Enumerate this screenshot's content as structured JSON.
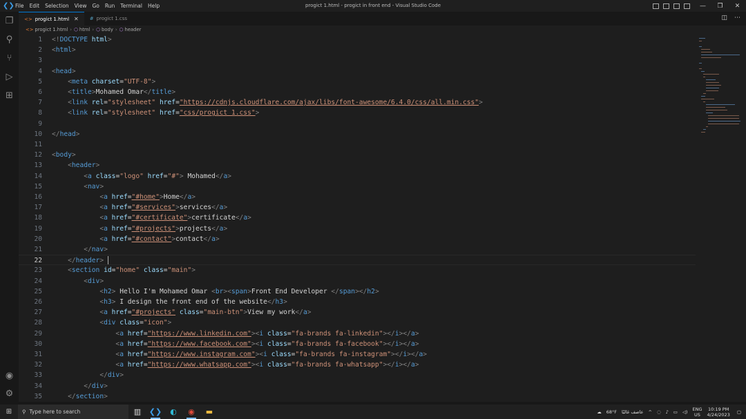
{
  "window": {
    "title": "progict 1.html - progict in front end - Visual Studio Code",
    "menu": [
      "File",
      "Edit",
      "Selection",
      "View",
      "Go",
      "Run",
      "Terminal",
      "Help"
    ]
  },
  "tabs": [
    {
      "label": "progict 1.html",
      "active": true,
      "icon": "html-file-icon"
    },
    {
      "label": "progict 1.css",
      "active": false,
      "icon": "css-file-icon"
    }
  ],
  "breadcrumb": [
    "progict 1.html",
    "html",
    "body",
    "header"
  ],
  "editor": {
    "current_line": 22,
    "lines": [
      {
        "n": "1",
        "code": "<!DOCTYPE html>"
      },
      {
        "n": "2",
        "code": "<html>"
      },
      {
        "n": "3",
        "code": ""
      },
      {
        "n": "4",
        "code": "<head>"
      },
      {
        "n": "5",
        "code": "    <meta charset=\"UTF-8\">"
      },
      {
        "n": "6",
        "code": "    <title>Mohamed Omar</title>"
      },
      {
        "n": "7",
        "code": "    <link rel=\"stylesheet\" href=\"https://cdnjs.cloudflare.com/ajax/libs/font-awesome/6.4.0/css/all.min.css\">"
      },
      {
        "n": "8",
        "code": "    <link rel=\"stylesheet\" href=\"css/progict 1.css\">"
      },
      {
        "n": "9",
        "code": ""
      },
      {
        "n": "10",
        "code": "</head>"
      },
      {
        "n": "11",
        "code": ""
      },
      {
        "n": "12",
        "code": "<body>"
      },
      {
        "n": "13",
        "code": "    <header>"
      },
      {
        "n": "14",
        "code": "        <a class=\"logo\" href=\"#\"> Mohamed</a>"
      },
      {
        "n": "15",
        "code": "        <nav>"
      },
      {
        "n": "16",
        "code": "            <a href=\"#home\">Home</a>"
      },
      {
        "n": "17",
        "code": "            <a href=\"#services\">services</a>"
      },
      {
        "n": "18",
        "code": "            <a href=\"#certificate\">certificate</a>"
      },
      {
        "n": "19",
        "code": "            <a href=\"#projects\">projects</a>"
      },
      {
        "n": "20",
        "code": "            <a href=\"#contact\">contact</a>"
      },
      {
        "n": "21",
        "code": "        </nav>"
      },
      {
        "n": "22",
        "code": "    </header>"
      },
      {
        "n": "23",
        "code": "    <section id=\"home\" class=\"main\">"
      },
      {
        "n": "24",
        "code": "        <div>"
      },
      {
        "n": "25",
        "code": "            <h2> Hello I'm Mohamed Omar <br><span>Front End Developer </span></h2>"
      },
      {
        "n": "26",
        "code": "            <h3> I design the front end of the website</h3>"
      },
      {
        "n": "27",
        "code": "            <a href=\"#projects\" class=\"main-btn\">View my work</a>"
      },
      {
        "n": "28",
        "code": "            <div class=\"icon\">"
      },
      {
        "n": "29",
        "code": "                <a href=\"https://www.linkedin.com\"><i class=\"fa-brands fa-linkedin\"></i></a>"
      },
      {
        "n": "30",
        "code": "                <a href=\"https://www.facebook.com\"><i class=\"fa-brands fa-facebook\"></i></a>"
      },
      {
        "n": "31",
        "code": "                <a href=\"https://www.instagram.com\"><i class=\"fa-brands fa-instagram\"></i></a>"
      },
      {
        "n": "32",
        "code": "                <a href=\"https://www.whatsapp.com\"><i class=\"fa-brands fa-whatsapp\"></i></a>"
      },
      {
        "n": "33",
        "code": "            </div>"
      },
      {
        "n": "34",
        "code": "        </div>"
      },
      {
        "n": "35",
        "code": "    </section>"
      }
    ]
  },
  "taskbar": {
    "search_placeholder": "Type here to search",
    "weather": "68°F",
    "weather_desc": "عاصف غالبًا",
    "lang": "ENG",
    "region": "US",
    "time": "10:19 PM",
    "date": "4/24/2023"
  },
  "colors": {
    "tag": "#569cd6",
    "attribute": "#9cdcfe",
    "string": "#ce9178",
    "text": "#d4d4d4",
    "accent": "#0078d4"
  }
}
